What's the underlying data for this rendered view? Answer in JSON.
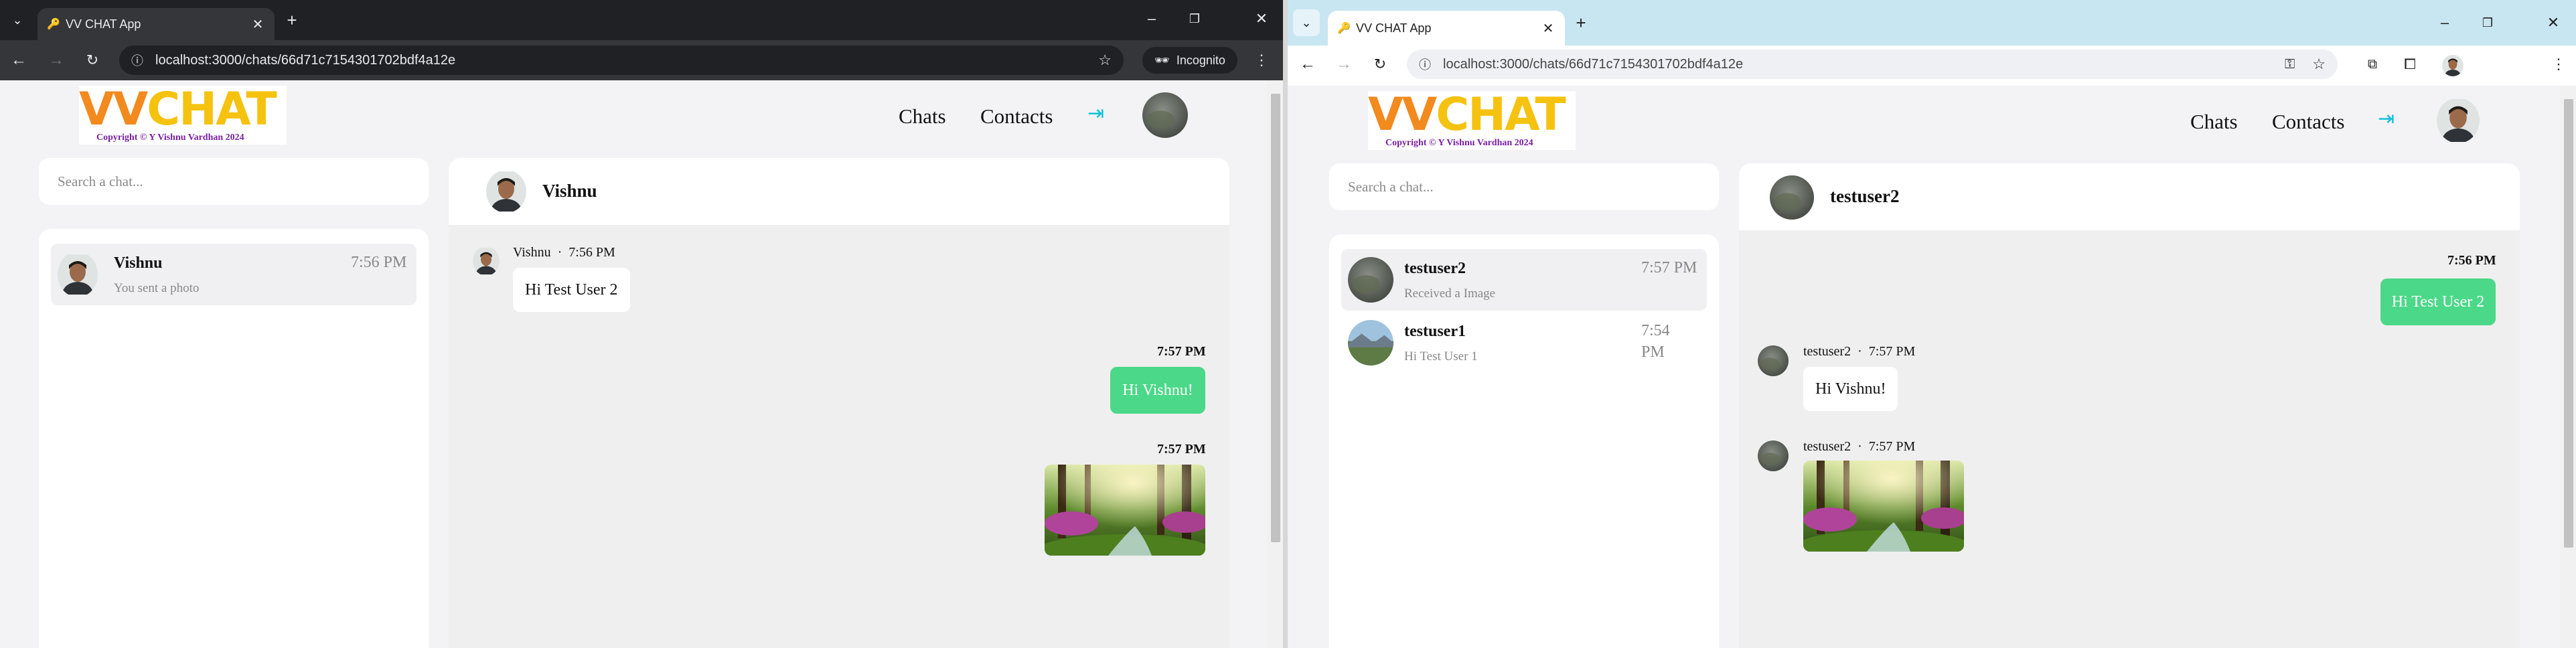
{
  "left": {
    "browser": {
      "tab_title": "VV CHAT App",
      "url": "localhost:3000/chats/66d71c7154301702bdf4a12e",
      "incognito_label": "Incognito"
    },
    "app": {
      "logo_text": "VVCHAT",
      "copyright": "Copyright © Y Vishnu Vardhan 2024",
      "nav_chats": "Chats",
      "nav_contacts": "Contacts",
      "search_placeholder": "Search a chat...",
      "chat_list": [
        {
          "name": "Vishnu",
          "time": "7:56 PM",
          "preview": "You sent a photo"
        }
      ],
      "chat_header_name": "Vishnu",
      "messages": [
        {
          "direction": "in",
          "sender": "Vishnu",
          "time": "7:56 PM",
          "text": "Hi Test User 2"
        },
        {
          "direction": "out",
          "time": "7:57 PM",
          "text": "Hi Vishnu!"
        },
        {
          "direction": "out",
          "time": "7:57 PM",
          "image": "forest-photo"
        }
      ]
    }
  },
  "right": {
    "browser": {
      "tab_title": "VV CHAT App",
      "url": "localhost:3000/chats/66d71c7154301702bdf4a12e"
    },
    "app": {
      "logo_text": "VVCHAT",
      "copyright": "Copyright © Y Vishnu Vardhan 2024",
      "nav_chats": "Chats",
      "nav_contacts": "Contacts",
      "search_placeholder": "Search a chat...",
      "chat_list": [
        {
          "name": "testuser2",
          "time": "7:57 PM",
          "preview": "Received a Image"
        },
        {
          "name": "testuser1",
          "time": "7:54 PM",
          "preview": "Hi Test User 1"
        }
      ],
      "chat_header_name": "testuser2",
      "messages": [
        {
          "direction": "out",
          "time": "7:56 PM",
          "text": "Hi Test User 2"
        },
        {
          "direction": "in",
          "sender": "testuser2",
          "time": "7:57 PM",
          "text": "Hi Vishnu!"
        },
        {
          "direction": "in",
          "sender": "testuser2",
          "time": "7:57 PM",
          "image": "forest-photo"
        }
      ]
    }
  },
  "meta_separator": "·",
  "colors": {
    "left_tabbar": "#202124",
    "left_toolbar": "#35363a",
    "right_tabbar": "#c8e6f1",
    "right_toolbar": "#ffffff",
    "accent_green": "#4bd888",
    "logout_cyan": "#13c2d8",
    "copyright_purple": "#7a1fa2",
    "app_bg": "#f3f3f5"
  }
}
